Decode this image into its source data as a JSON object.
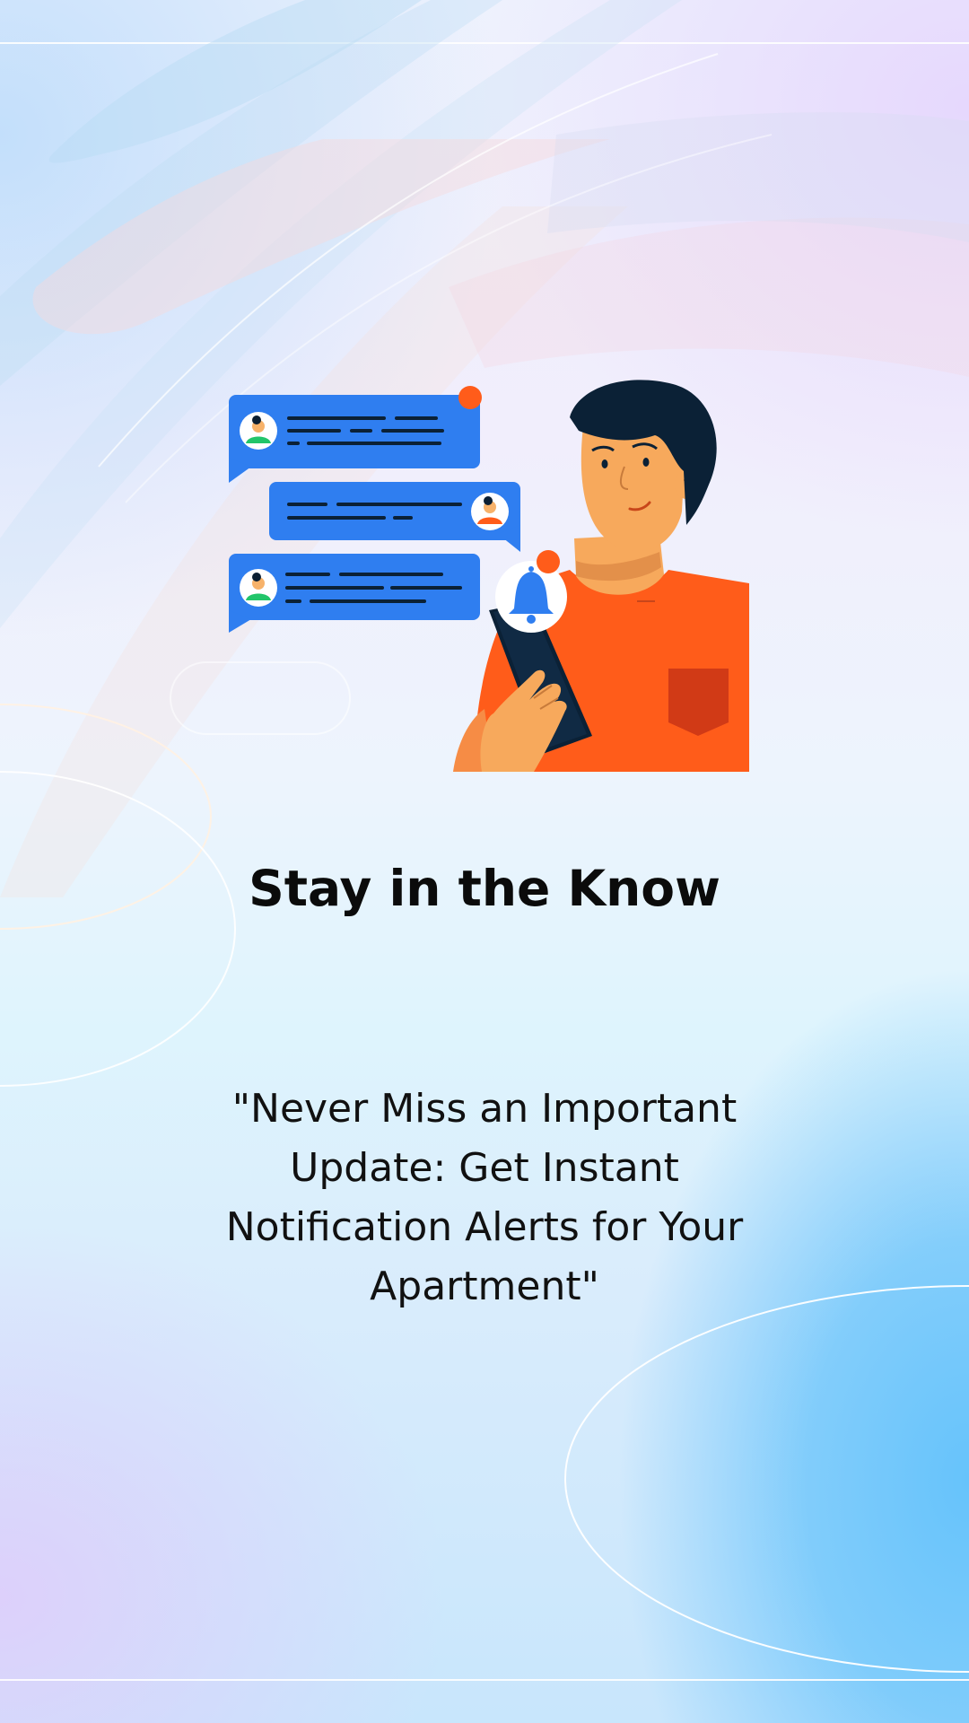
{
  "slide": {
    "headline": "Stay in the Know",
    "quote": "\"Never Miss an Important Update: Get Instant Notification Alerts for Your Apartment\""
  },
  "illustration": {
    "icon_name": "bell-icon",
    "subject": "person-holding-phone-icon",
    "message_icon": "chat-bubble-icon"
  },
  "colors": {
    "accent_blue": "#2f7ef0",
    "accent_orange": "#ff5c1a",
    "text_dark": "#0b0b0b",
    "gradient_blue": "#66c3fb",
    "gradient_lavender": "#ddd0fb"
  }
}
